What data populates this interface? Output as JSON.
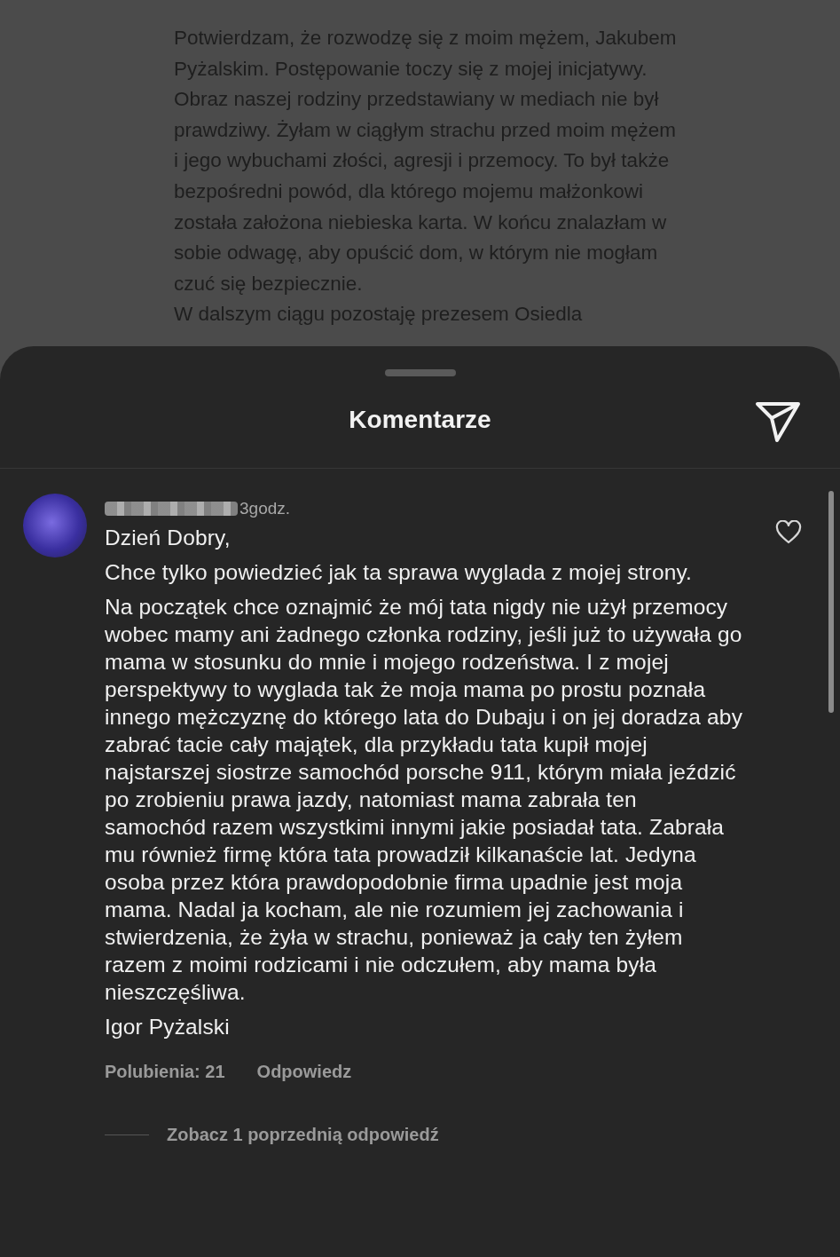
{
  "post": {
    "paragraphs": [
      "Potwierdzam, że rozwodzę się z moim mężem, Jakubem Pyżalskim. Postępowanie toczy się z mojej inicjatywy. Obraz naszej rodziny przedstawiany w mediach nie był prawdziwy. Żyłam w ciągłym strachu przed moim mężem i jego wybuchami złości, agresji i przemocy. To był także bezpośredni powód, dla którego mojemu małżonkowi została założona niebieska karta. W końcu znalazłam w sobie odwagę, aby opuścić dom, w którym nie mogłam czuć się bezpiecznie.",
      "W dalszym ciągu pozostaję prezesem Osiedla"
    ]
  },
  "sheet": {
    "title": "Komentarze"
  },
  "comments": [
    {
      "time": "3godz.",
      "liked": false,
      "paragraphs": [
        "Dzień Dobry,",
        "Chce tylko powiedzieć jak ta sprawa wyglada z mojej strony.",
        "Na początek chce oznajmić że mój tata nigdy nie użył przemocy wobec mamy ani żadnego członka rodziny, jeśli już to używała go mama w stosunku do mnie i mojego rodzeństwa. I z mojej perspektywy to wyglada tak że moja mama po prostu poznała innego mężczyznę do którego lata do Dubaju i on jej doradza aby zabrać tacie cały majątek, dla przykładu tata kupił mojej najstarszej siostrze samochód porsche 911, którym miała jeździć po zrobieniu prawa jazdy, natomiast mama zabrała ten samochód razem wszystkimi innymi jakie posiadał tata. Zabrała mu również firmę która tata prowadził kilkanaście lat. Jedyna osoba przez która prawdopodobnie firma upadnie jest moja mama. Nadal ja kocham, ale nie rozumiem jej zachowania i stwierdzenia, że żyła w strachu, ponieważ ja cały ten żyłem razem z moimi rodzicami i nie odczułem, aby mama była nieszczęśliwa.",
        "Igor Pyżalski"
      ],
      "likes": "Polubienia: 21",
      "reply": "Odpowiedz",
      "more_replies": "Zobacz 1 poprzednią odpowiedź"
    }
  ]
}
